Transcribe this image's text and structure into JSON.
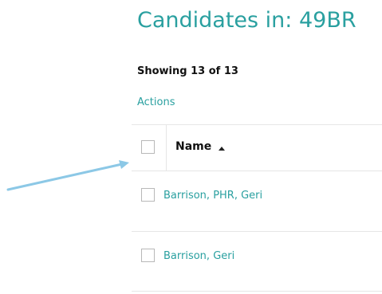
{
  "page": {
    "title": "Candidates in: 49BR",
    "showing": "Showing 13 of 13",
    "actions_label": "Actions"
  },
  "table": {
    "columns": [
      {
        "label": "Name",
        "sort": "ascending",
        "sort_icon": "sort-ascending-icon"
      }
    ],
    "rows": [
      {
        "name": "Barrison, PHR, Geri"
      },
      {
        "name": "Barrison, Geri"
      }
    ]
  },
  "colors": {
    "accent": "#2aa0a0",
    "annotation_arrow": "#8cc8e6",
    "border": "#e6e6e6",
    "text": "#111111"
  }
}
